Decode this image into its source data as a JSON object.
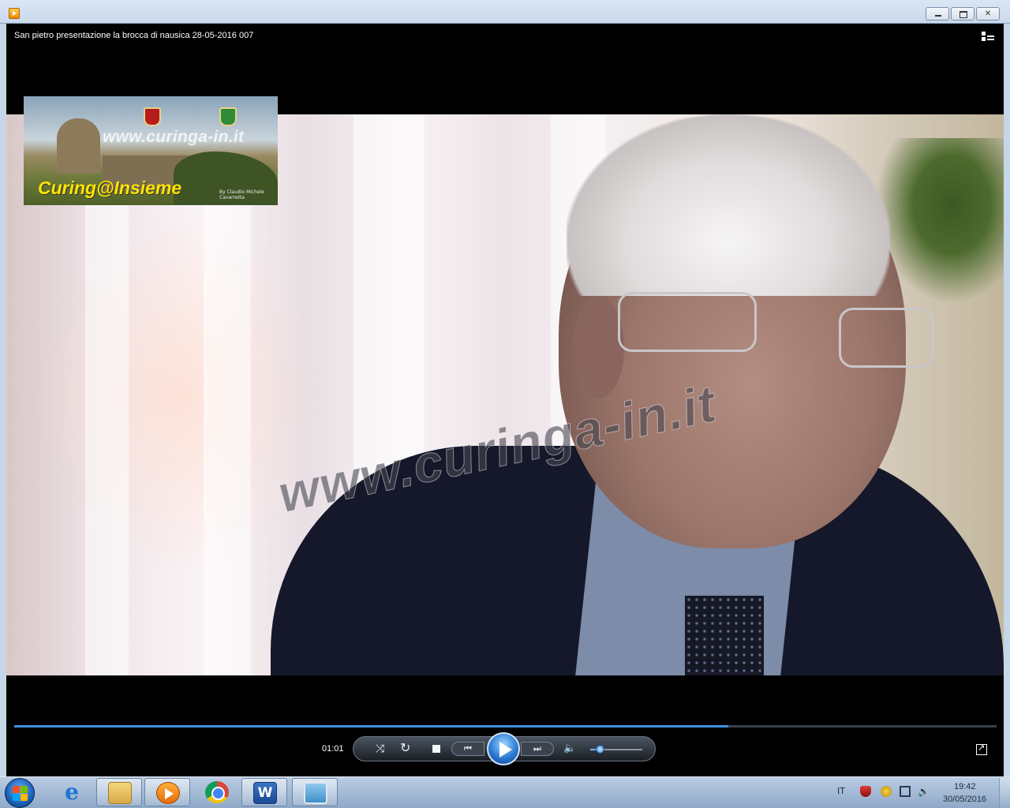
{
  "window": {
    "buttons": [
      "minimize",
      "maximize",
      "close"
    ]
  },
  "player": {
    "video_title": "San pietro presentazione la brocca di nausica 28-05-2016 007",
    "switch_icon": "switch-to-library-icon",
    "overlay": {
      "logo_url": "www.curinga-in.it",
      "logo_title": "Curing@Insieme",
      "logo_byline": "By Claudio Michele Cavarretta",
      "watermark": "www.curinga-in.it"
    },
    "progress_fraction": 0.727,
    "accent_color": "#3d8fe0",
    "time_elapsed": "01:01",
    "volume_fraction": 0.2
  },
  "taskbar": {
    "items": [
      {
        "name": "internet-explorer-icon",
        "label": "e"
      },
      {
        "name": "file-explorer-icon",
        "label": ""
      },
      {
        "name": "windows-media-player-icon",
        "label": ""
      },
      {
        "name": "chrome-icon",
        "label": ""
      },
      {
        "name": "word-icon",
        "label": "W"
      },
      {
        "name": "photo-viewer-icon",
        "label": ""
      }
    ],
    "language": "IT",
    "clock_time": "19:42",
    "clock_date": "30/05/2016"
  }
}
